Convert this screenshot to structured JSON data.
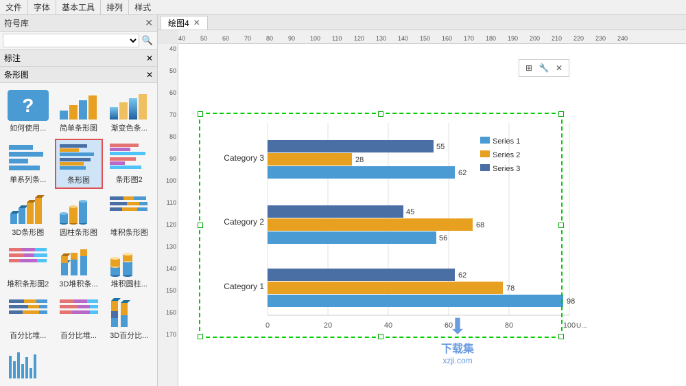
{
  "toolbar": {
    "sections": [
      "文件",
      "字体",
      "基本工具",
      "排列",
      "样式"
    ]
  },
  "tabs": [
    {
      "label": "绘图4",
      "active": true,
      "closable": true
    }
  ],
  "leftPanel": {
    "symbolLibrary": {
      "title": "符号库",
      "placeholder": ""
    },
    "labelSection": {
      "title": "标注"
    },
    "barChartSection": {
      "title": "条形图",
      "items": [
        {
          "id": "how-to",
          "label": "如何使用...",
          "type": "question"
        },
        {
          "id": "simple",
          "label": "简单条形图",
          "type": "simple-bar"
        },
        {
          "id": "gradient",
          "label": "渐变色条...",
          "type": "gradient-bar"
        },
        {
          "id": "single-series",
          "label": "单系列条...",
          "type": "single-series"
        },
        {
          "id": "bar-chart",
          "label": "条形图",
          "type": "bar-selected",
          "selected": true
        },
        {
          "id": "bar-chart2",
          "label": "条形图2",
          "type": "bar2"
        },
        {
          "id": "3d-bar",
          "label": "3D条形图",
          "type": "3d-bar"
        },
        {
          "id": "cylinder-bar",
          "label": "圆柱条形图",
          "type": "cylinder-bar"
        },
        {
          "id": "stacked-bar",
          "label": "堆积条形图",
          "type": "stacked-bar"
        },
        {
          "id": "stacked-bar2",
          "label": "堆积条形图2",
          "type": "stacked-bar2"
        },
        {
          "id": "3d-stacked",
          "label": "3D堆积条...",
          "type": "3d-stacked"
        },
        {
          "id": "stacked-cylinder",
          "label": "堆积圆柱...",
          "type": "stacked-cylinder"
        },
        {
          "id": "percent-bar",
          "label": "百分比堆...",
          "type": "percent-bar"
        },
        {
          "id": "percent-bar2",
          "label": "百分比堆...",
          "type": "percent-bar"
        },
        {
          "id": "3d-percent",
          "label": "3D百分比...",
          "type": "3d-percent"
        },
        {
          "id": "more1",
          "label": "",
          "type": "more-bars"
        }
      ]
    }
  },
  "chart": {
    "title": "绘图4",
    "categories": [
      "Category 1",
      "Category 2",
      "Category 3"
    ],
    "series": [
      {
        "name": "Series 1",
        "color": "#4a9ad4",
        "values": [
          62,
          56,
          62
        ]
      },
      {
        "name": "Series 2",
        "color": "#e8a020",
        "values": [
          78,
          68,
          28
        ]
      },
      {
        "name": "Series 3",
        "color": "#4a6fa5",
        "values": [
          98,
          45,
          55
        ]
      }
    ],
    "xAxisValues": [
      "0",
      "20",
      "40",
      "60",
      "80",
      "100"
    ],
    "toolbarIcons": [
      "table-icon",
      "wrench-icon"
    ],
    "selectionHandles": [
      "tl",
      "tm",
      "tr",
      "ml",
      "mr",
      "bl",
      "bm",
      "br"
    ]
  },
  "ruler": {
    "horizontal": [
      "40",
      "50",
      "60",
      "70",
      "80",
      "90",
      "100",
      "110",
      "120",
      "130",
      "140",
      "150",
      "160",
      "170",
      "180",
      "190",
      "200",
      "210",
      "220",
      "230",
      "240"
    ],
    "vertical": [
      "40",
      "50",
      "60",
      "70",
      "80",
      "90",
      "100",
      "110",
      "120",
      "130",
      "140",
      "150",
      "160",
      "170"
    ]
  },
  "watermark": {
    "arrow": "↓",
    "line1": "下载集",
    "line2": "xzji.com"
  }
}
